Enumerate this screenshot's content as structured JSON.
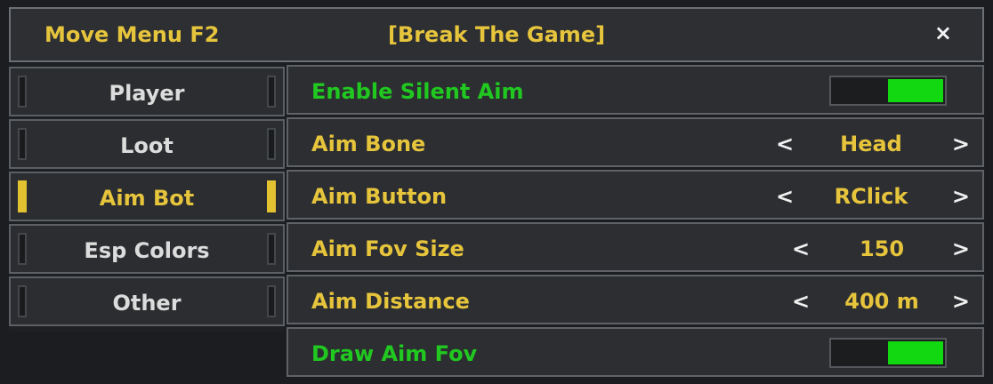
{
  "header": {
    "move_hint": "Move Menu F2",
    "title": "[Break The Game]",
    "close": "×"
  },
  "sidebar": {
    "items": [
      {
        "label": "Player",
        "active": false
      },
      {
        "label": "Loot",
        "active": false
      },
      {
        "label": "Aim Bot",
        "active": true
      },
      {
        "label": "Esp Colors",
        "active": false
      },
      {
        "label": "Other",
        "active": false
      }
    ]
  },
  "options": {
    "silent_aim": {
      "label": "Enable Silent Aim",
      "state": "on"
    },
    "aim_bone": {
      "label": "Aim Bone",
      "prev": "<",
      "value": "Head",
      "next": ">"
    },
    "aim_button": {
      "label": "Aim Button",
      "prev": "<",
      "value": "RClick",
      "next": ">"
    },
    "aim_fov_size": {
      "label": "Aim Fov Size",
      "prev": "<",
      "value": "150",
      "next": ">"
    },
    "aim_distance": {
      "label": "Aim Distance",
      "prev": "<",
      "value": "400 m",
      "next": ">"
    },
    "draw_aim_fov": {
      "label": "Draw Aim Fov",
      "state": "on"
    }
  },
  "colors": {
    "accent_yellow": "#e6c43c",
    "toggle_green": "#12d812",
    "label_green": "#20c820",
    "panel": "#2c2e31",
    "border": "#5f6266"
  }
}
